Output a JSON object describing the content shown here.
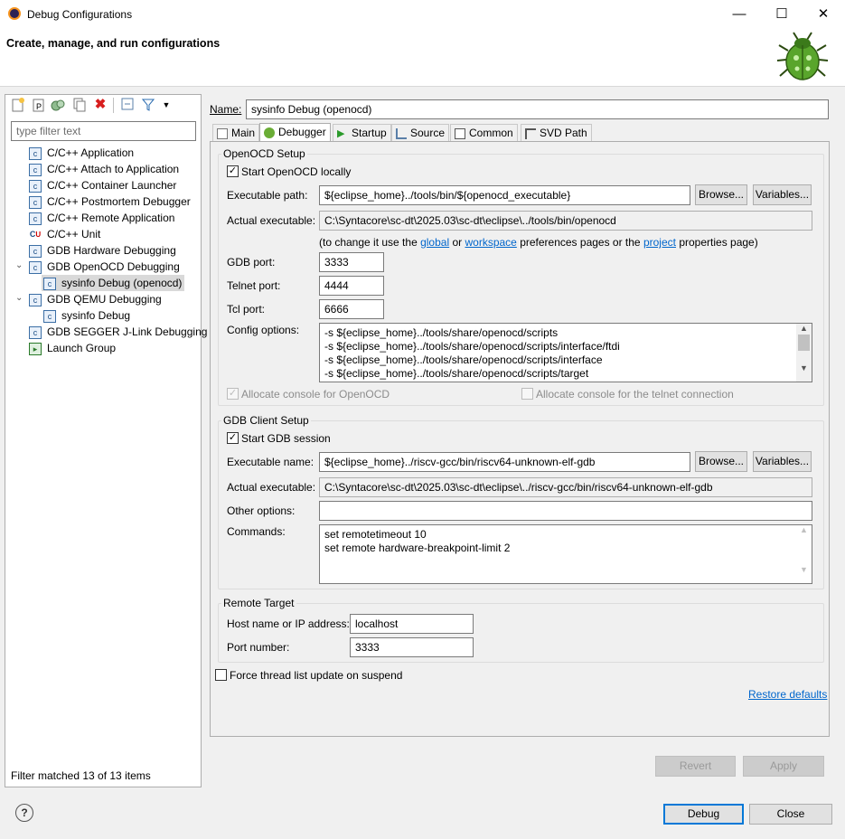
{
  "window": {
    "title": "Debug Configurations"
  },
  "header": {
    "title": "Create, manage, and run configurations"
  },
  "toolbar": {
    "icons": [
      "new-configuration-icon",
      "new-prototype-icon",
      "duplicate-icon",
      "export-icon",
      "delete-icon",
      "collapse-all-icon",
      "filter-icon",
      "view-menu-icon"
    ]
  },
  "filter": {
    "placeholder": "type filter text",
    "status": "Filter matched 13 of 13 items"
  },
  "tree": {
    "items": [
      {
        "label": "C/C++ Application"
      },
      {
        "label": "C/C++ Attach to Application"
      },
      {
        "label": "C/C++ Container Launcher"
      },
      {
        "label": "C/C++ Postmortem Debugger"
      },
      {
        "label": "C/C++ Remote Application"
      },
      {
        "label": "C/C++ Unit"
      },
      {
        "label": "GDB Hardware Debugging"
      },
      {
        "label": "GDB OpenOCD Debugging"
      },
      {
        "label": "sysinfo Debug (openocd)"
      },
      {
        "label": "GDB QEMU Debugging"
      },
      {
        "label": "sysinfo Debug"
      },
      {
        "label": "GDB SEGGER J-Link Debugging"
      },
      {
        "label": "Launch Group"
      }
    ]
  },
  "name": {
    "label": "Name:",
    "value": "sysinfo Debug (openocd)"
  },
  "tabs": [
    {
      "label": "Main"
    },
    {
      "label": "Debugger"
    },
    {
      "label": "Startup"
    },
    {
      "label": "Source"
    },
    {
      "label": "Common"
    },
    {
      "label": "SVD Path"
    }
  ],
  "openocd": {
    "group": "OpenOCD Setup",
    "start_label": "Start OpenOCD locally",
    "start_checked": true,
    "exec_label": "Executable path:",
    "exec_value": "${eclipse_home}../tools/bin/${openocd_executable}",
    "actual_label": "Actual executable:",
    "actual_value": "C:\\Syntacore\\sc-dt\\2025.03\\sc-dt\\eclipse\\../tools/bin/openocd",
    "hint_pre": "(to change it use the",
    "hint_global": "global",
    "hint_or": "or",
    "hint_workspace": "workspace",
    "hint_mid": "preferences pages or the",
    "hint_project": "project",
    "hint_post": "properties page)",
    "gdb_port_label": "GDB port:",
    "gdb_port": "3333",
    "telnet_port_label": "Telnet port:",
    "telnet_port": "4444",
    "tcl_port_label": "Tcl port:",
    "tcl_port": "6666",
    "config_label": "Config options:",
    "config_lines": [
      "-s ${eclipse_home}../tools/share/openocd/scripts",
      "-s ${eclipse_home}../tools/share/openocd/scripts/interface/ftdi",
      "-s ${eclipse_home}../tools/share/openocd/scripts/interface",
      "-s ${eclipse_home}../tools/share/openocd/scripts/target"
    ],
    "alloc_console_label": "Allocate console for OpenOCD",
    "alloc_telnet_label": "Allocate console for the telnet connection"
  },
  "gdb": {
    "group": "GDB Client Setup",
    "start_label": "Start GDB session",
    "exec_label": "Executable name:",
    "exec_value": "${eclipse_home}../riscv-gcc/bin/riscv64-unknown-elf-gdb",
    "actual_label": "Actual executable:",
    "actual_value": "C:\\Syntacore\\sc-dt\\2025.03\\sc-dt\\eclipse\\../riscv-gcc/bin/riscv64-unknown-elf-gdb",
    "other_label": "Other options:",
    "other_value": "",
    "commands_label": "Commands:",
    "commands_lines": [
      "set remotetimeout 10",
      "set remote hardware-breakpoint-limit 2"
    ]
  },
  "remote": {
    "group": "Remote Target",
    "host_label": "Host name or IP address:",
    "host_value": "localhost",
    "port_label": "Port number:",
    "port_value": "3333"
  },
  "force_thread_label": "Force thread list update on suspend",
  "restore_defaults": "Restore defaults",
  "buttons": {
    "browse": "Browse...",
    "variables": "Variables...",
    "revert": "Revert",
    "apply": "Apply",
    "debug": "Debug",
    "close": "Close",
    "minimize": "—",
    "maximize": "☐",
    "close_win": "✕"
  }
}
